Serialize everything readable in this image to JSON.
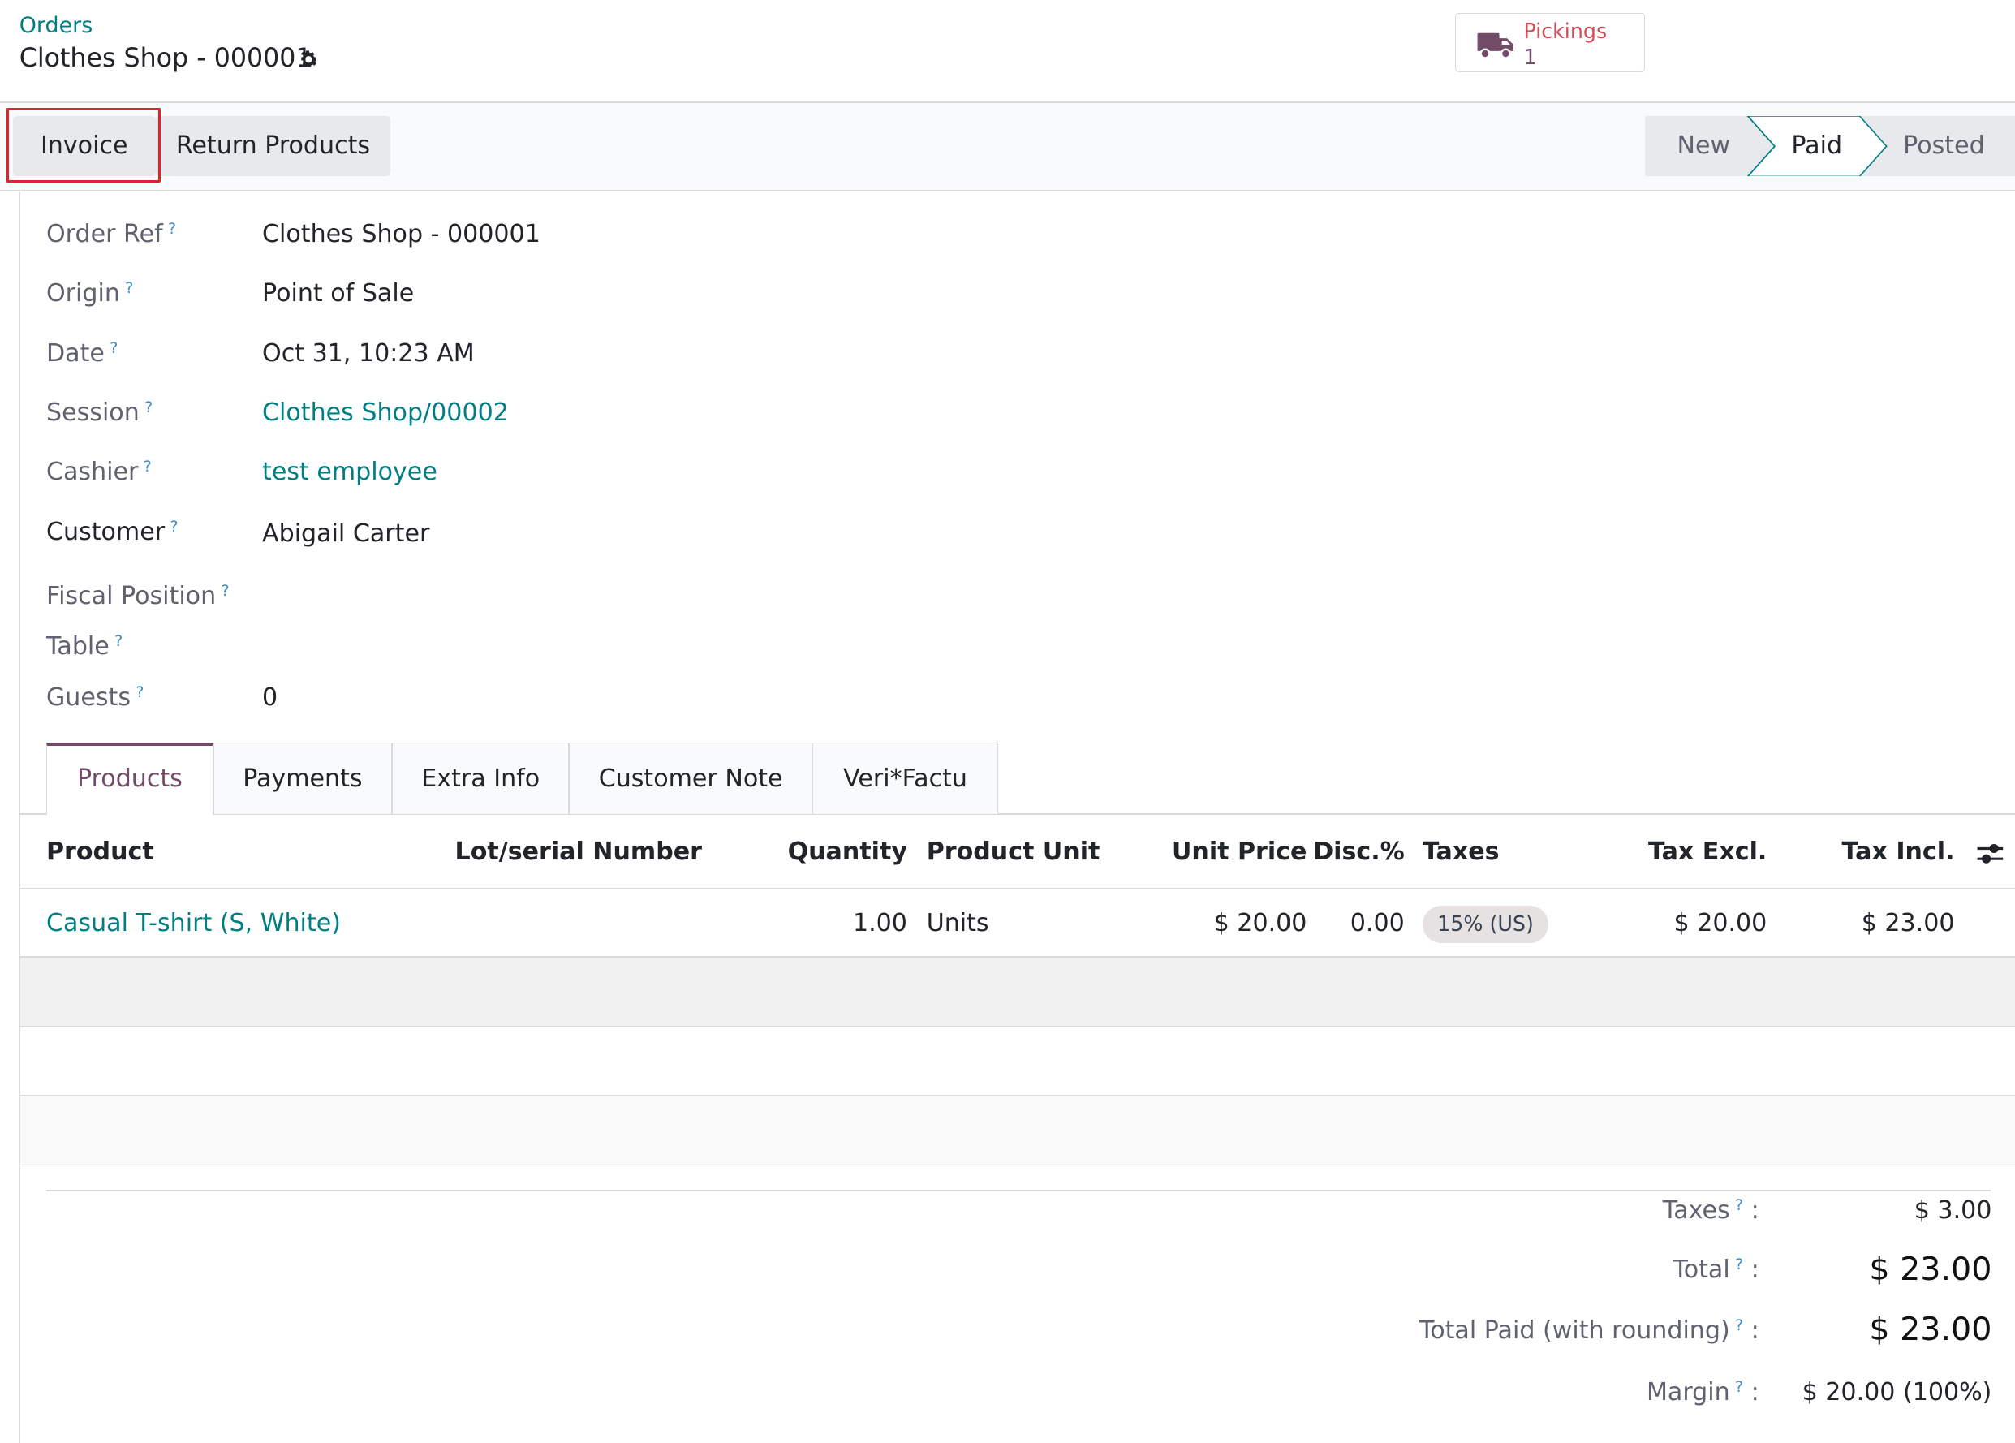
{
  "breadcrumb": {
    "parent": "Orders",
    "current": "Clothes Shop - 000001"
  },
  "smart_button": {
    "label": "Pickings",
    "value": "1",
    "icon": "truck-icon"
  },
  "actions": {
    "invoice": "Invoice",
    "return_products": "Return Products"
  },
  "statusbar": {
    "stages": [
      "New",
      "Paid",
      "Posted"
    ],
    "active": "Paid"
  },
  "fields": {
    "order_ref": {
      "label": "Order Ref",
      "value": "Clothes Shop - 000001"
    },
    "origin": {
      "label": "Origin",
      "value": "Point of Sale"
    },
    "date": {
      "label": "Date",
      "value": "Oct 31, 10:23 AM"
    },
    "session": {
      "label": "Session",
      "value": "Clothes Shop/00002"
    },
    "cashier": {
      "label": "Cashier",
      "value": "test employee"
    },
    "customer": {
      "label": "Customer",
      "value": "Abigail Carter"
    },
    "fiscal_position": {
      "label": "Fiscal Position",
      "value": ""
    },
    "table": {
      "label": "Table",
      "value": ""
    },
    "guests": {
      "label": "Guests",
      "value": "0"
    }
  },
  "help_mark": "?",
  "tabs": [
    "Products",
    "Payments",
    "Extra Info",
    "Customer Note",
    "Veri*Factu"
  ],
  "table": {
    "headers": [
      "Product",
      "Lot/serial Number",
      "Quantity",
      "Product Unit",
      "Unit Price",
      "Disc.%",
      "Taxes",
      "Tax Excl.",
      "Tax Incl."
    ],
    "rows": [
      {
        "product": "Casual T-shirt (S, White)",
        "lot": "",
        "quantity": "1.00",
        "unit": "Units",
        "unit_price": "$ 20.00",
        "discount": "0.00",
        "taxes": "15% (US)",
        "tax_excl": "$ 20.00",
        "tax_incl": "$ 23.00"
      }
    ]
  },
  "summary": {
    "taxes": {
      "label": "Taxes",
      "value": "$ 3.00"
    },
    "total": {
      "label": "Total",
      "value": "$ 23.00"
    },
    "total_paid": {
      "label": "Total Paid (with rounding)",
      "value": "$ 23.00"
    },
    "margin": {
      "label": "Margin",
      "value": "$ 20.00 (100%)"
    }
  },
  "colors": {
    "link": "#017e84",
    "brand": "#714b67",
    "highlight": "#d9262a",
    "pickings": "#d44c59"
  }
}
